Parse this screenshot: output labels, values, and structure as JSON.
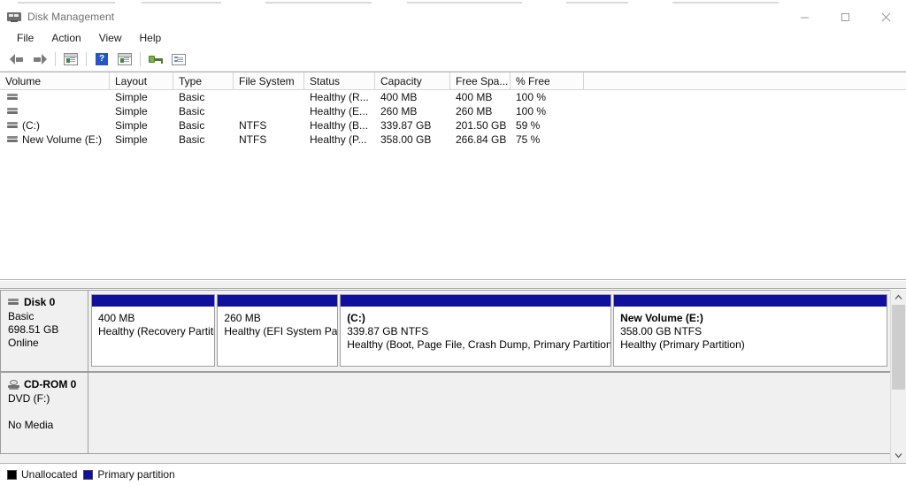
{
  "window": {
    "title": "Disk Management",
    "app_icon": "disk-management-icon",
    "controls": {
      "minimize": "–",
      "maximize": "□",
      "close": "✕"
    }
  },
  "menubar": {
    "items": [
      "File",
      "Action",
      "View",
      "Help"
    ]
  },
  "toolbar": {
    "items": [
      {
        "name": "back-button",
        "icon": "arrow-left-icon"
      },
      {
        "name": "forward-button",
        "icon": "arrow-right-icon"
      },
      {
        "name": "show-hide-console-tree-button",
        "icon": "console-tree-icon"
      },
      {
        "name": "help-button",
        "icon": "help-question-icon"
      },
      {
        "name": "action-menu-button",
        "icon": "window-play-icon"
      },
      {
        "name": "rescan-disks-button",
        "icon": "key-icon"
      },
      {
        "name": "properties-button",
        "icon": "properties-list-icon"
      }
    ]
  },
  "volume_list": {
    "columns": [
      "Volume",
      "Layout",
      "Type",
      "File System",
      "Status",
      "Capacity",
      "Free Spa...",
      "% Free"
    ],
    "rows": [
      {
        "volume": "",
        "layout": "Simple",
        "type": "Basic",
        "file_system": "",
        "status": "Healthy (R...",
        "capacity": "400 MB",
        "free_space": "400 MB",
        "percent_free": "100 %"
      },
      {
        "volume": "",
        "layout": "Simple",
        "type": "Basic",
        "file_system": "",
        "status": "Healthy (E...",
        "capacity": "260 MB",
        "free_space": "260 MB",
        "percent_free": "100 %"
      },
      {
        "volume": "(C:)",
        "layout": "Simple",
        "type": "Basic",
        "file_system": "NTFS",
        "status": "Healthy (B...",
        "capacity": "339.87 GB",
        "free_space": "201.50 GB",
        "percent_free": "59 %"
      },
      {
        "volume": "New Volume (E:)",
        "layout": "Simple",
        "type": "Basic",
        "file_system": "NTFS",
        "status": "Healthy (P...",
        "capacity": "358.00 GB",
        "free_space": "266.84 GB",
        "percent_free": "75 %"
      }
    ]
  },
  "graphic_view": {
    "disks": [
      {
        "name": "Disk 0",
        "icon": "disk-icon",
        "type": "Basic",
        "size": "698.51 GB",
        "status": "Online",
        "partitions": [
          {
            "name": "",
            "size": "400 MB",
            "status": "Healthy (Recovery Partitio",
            "color": "#10109c",
            "width_pct": 15.6
          },
          {
            "name": "",
            "size": "260 MB",
            "status": "Healthy (EFI System Par",
            "color": "#10109c",
            "width_pct": 15.2
          },
          {
            "name": "(C:)",
            "size": "339.87 GB NTFS",
            "status": "Healthy (Boot, Page File, Crash Dump, Primary Partition)",
            "color": "#10109c",
            "width_pct": 34.1
          },
          {
            "name": "New Volume  (E:)",
            "size": "358.00 GB NTFS",
            "status": "Healthy (Primary Partition)",
            "color": "#10109c",
            "width_pct": 35.1
          }
        ]
      },
      {
        "name": "CD-ROM 0",
        "icon": "cdrom-icon",
        "type": "DVD (F:)",
        "size": "",
        "status": "No Media",
        "partitions": []
      }
    ]
  },
  "legend": {
    "items": [
      {
        "label": "Unallocated",
        "color": "#000000"
      },
      {
        "label": "Primary partition",
        "color": "#10109c"
      }
    ]
  }
}
